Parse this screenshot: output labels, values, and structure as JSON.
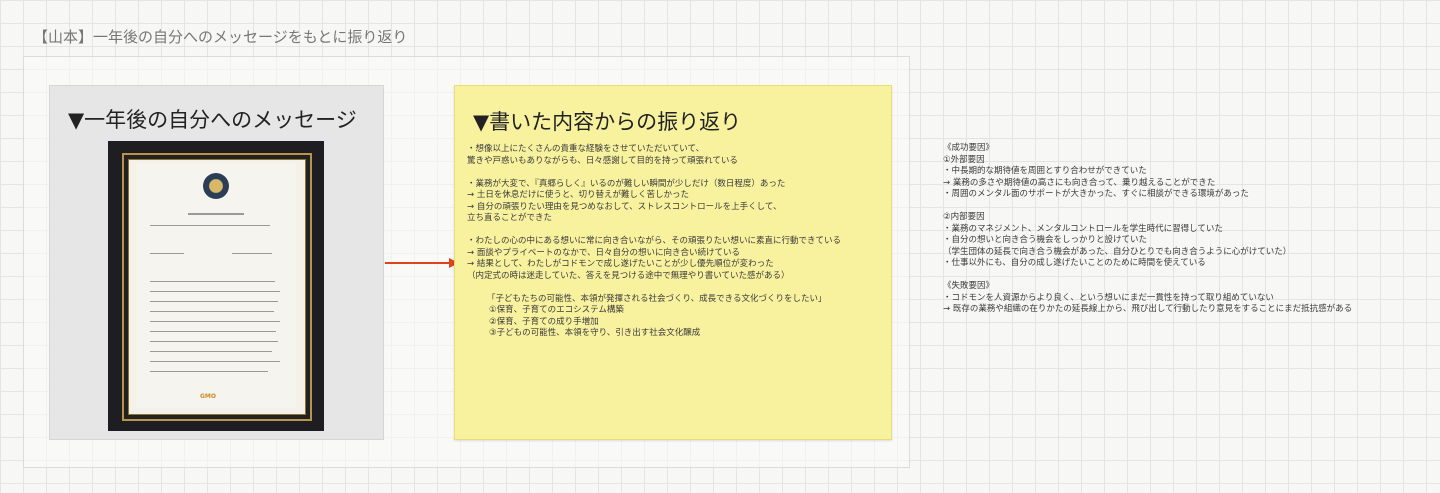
{
  "board": {
    "title": "【山本】一年後の自分へのメッセージをもとに振り返り"
  },
  "left_panel": {
    "title": "▼一年後の自分へのメッセージ",
    "photo": {
      "letter_heading": "1年後の私へ",
      "brand": "GMO"
    }
  },
  "arrow": {
    "color": "#e0421c"
  },
  "sticky": {
    "title": "▼書いた内容からの振り返り",
    "color": "#f8f29f",
    "lines": [
      "・想像以上にたくさんの貴重な経験をさせていただいていて、",
      "驚きや戸惑いもありながらも、日々感謝して目的を持って頑張れている",
      "",
      "・業務が大変で、『真郷らしく』いるのが難しい瞬間が少しだけ（数日程度）あった",
      "→ 土日を休息だけに使うと、切り替えが難しく苦しかった",
      "→ 自分の頑張りたい理由を見つめなおして、ストレスコントロールを上手くして、",
      "立ち直ることができた",
      "",
      "・わたしの心の中にある想いに常に向き合いながら、その頑張りたい想いに素直に行動できている",
      "→ 面談やプライベートのなかで、日々自分の想いに向き合い続けている",
      "→ 結果として、わたしがコドモンで成し遂げたいことが少し優先順位が変わった",
      "（内定式の時は迷走していた、答えを見つける途中で無理やり書いていた感がある）",
      "",
      "「子どもたちの可能性、本領が発揮される社会づくり、成長できる文化づくりをしたい」",
      "①保育、子育てのエコシステム構築",
      "②保育、子育ての成り手増加",
      "③子どもの可能性、本領を守り、引き出す社会文化醸成"
    ]
  },
  "notes": {
    "lines": [
      "《成功要因》",
      "①外部要因",
      "・中長期的な期待値を周囲とすり合わせができていた",
      "→ 業務の多さや期待値の高さにも向き合って、乗り越えることができた",
      "・周囲のメンタル面のサポートが大きかった、すぐに相談ができる環境があった",
      "",
      "②内部要因",
      "・業務のマネジメント、メンタルコントロールを学生時代に習得していた",
      "・自分の想いと向き合う機会をしっかりと設けていた",
      "（学生団体の延長で向き合う機会があった、自分ひとりでも向き合うように心がけていた）",
      "・仕事以外にも、自分の成し遂げたいことのために時間を使えている",
      "",
      "《失敗要因》",
      "・コドモンを人資源からより良く、という想いにまだ一貫性を持って取り組めていない",
      "→ 既存の業務や組織の在りかたの延長線上から、飛び出して行動したり意見をすることにまだ抵抗感がある"
    ]
  }
}
